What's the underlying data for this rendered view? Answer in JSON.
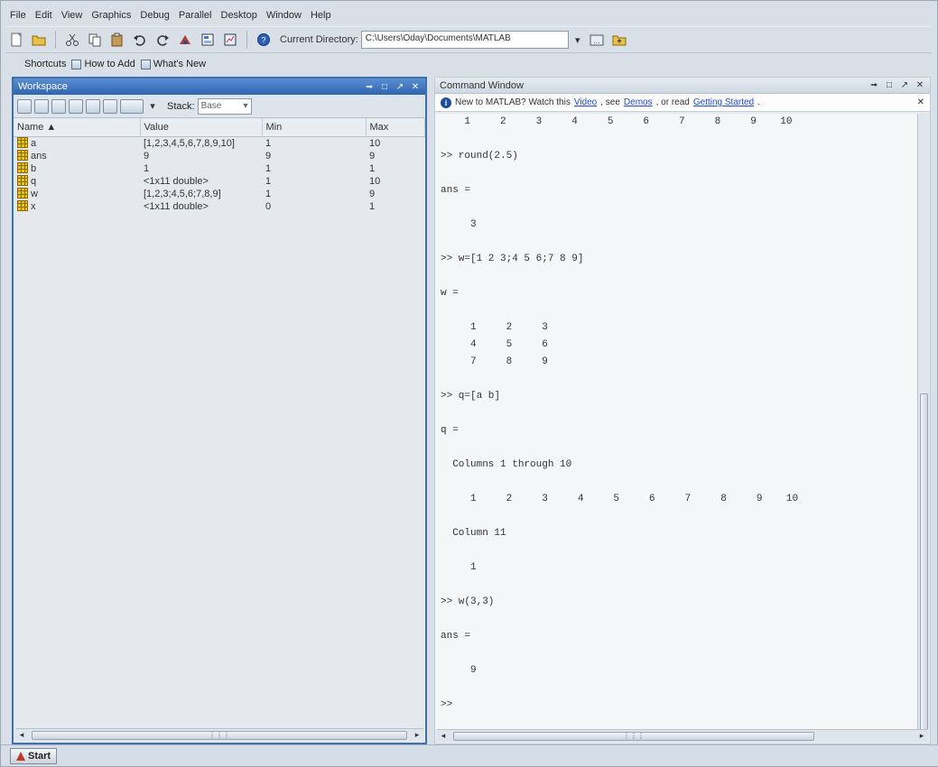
{
  "menubar": [
    "File",
    "Edit",
    "View",
    "Graphics",
    "Debug",
    "Parallel",
    "Desktop",
    "Window",
    "Help"
  ],
  "toolbar": {
    "current_directory_label": "Current Directory:",
    "current_directory_value": "C:\\Users\\Oday\\Documents\\MATLAB"
  },
  "shortcuts": {
    "shortcuts_label": "Shortcuts",
    "how_to_add_label": "How to Add",
    "whats_new_label": "What's New"
  },
  "workspace": {
    "title": "Workspace",
    "stack_label": "Stack:",
    "stack_value": "Base",
    "columns": [
      "Name ▲",
      "Value",
      "Min",
      "Max"
    ],
    "rows": [
      {
        "name": "a",
        "value": "[1,2,3,4,5,6,7,8,9,10]",
        "min": "1",
        "max": "10"
      },
      {
        "name": "ans",
        "value": "9",
        "min": "9",
        "max": "9"
      },
      {
        "name": "b",
        "value": "1",
        "min": "1",
        "max": "1"
      },
      {
        "name": "q",
        "value": "<1x11 double>",
        "min": "1",
        "max": "10"
      },
      {
        "name": "w",
        "value": "[1,2,3;4,5,6;7,8,9]",
        "min": "1",
        "max": "9"
      },
      {
        "name": "x",
        "value": "<1x11 double>",
        "min": "0",
        "max": "1"
      }
    ]
  },
  "command_window": {
    "title": "Command Window",
    "info_prefix": "New to MATLAB? Watch this",
    "info_link_video": "Video",
    "info_mid": ", see",
    "info_link_demos": "Demos",
    "info_mid2": ", or read",
    "info_link_getting_started": "Getting Started",
    "info_suffix": ".",
    "lines": [
      "    1     2     3     4     5     6     7     8     9    10",
      "",
      ">> round(2.5)",
      "",
      "ans =",
      "",
      "     3",
      "",
      ">> w=[1 2 3;4 5 6;7 8 9]",
      "",
      "w =",
      "",
      "     1     2     3",
      "     4     5     6",
      "     7     8     9",
      "",
      ">> q=[a b]",
      "",
      "q =",
      "",
      "  Columns 1 through 10",
      "",
      "     1     2     3     4     5     6     7     8     9    10",
      "",
      "  Column 11",
      "",
      "     1",
      "",
      ">> w(3,3)",
      "",
      "ans =",
      "",
      "     9",
      "",
      ">>"
    ]
  },
  "startbar": {
    "start_label": "Start"
  }
}
